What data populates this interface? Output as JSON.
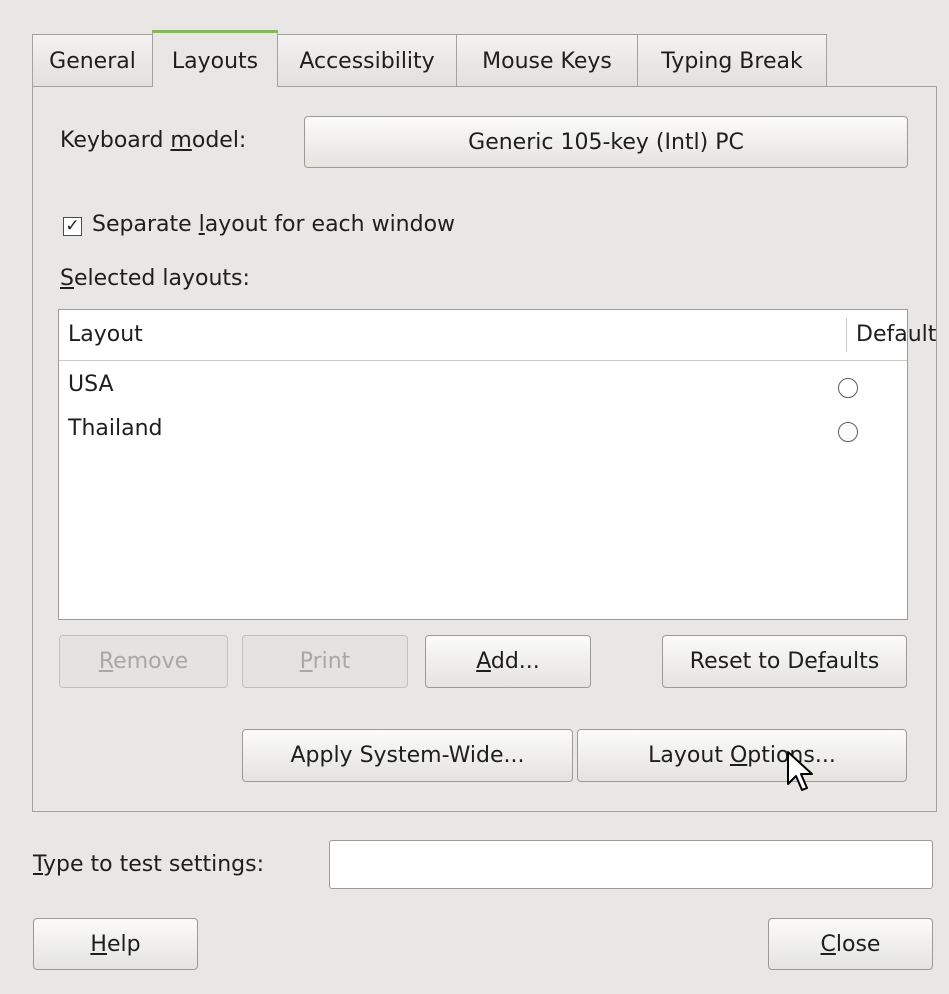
{
  "tabs": [
    {
      "label": "General"
    },
    {
      "label": "Layouts"
    },
    {
      "label": "Accessibility"
    },
    {
      "label": "Mouse Keys"
    },
    {
      "label": "Typing Break"
    }
  ],
  "keyboard_model": {
    "label_pre": "Keyboard ",
    "label_mnemonic": "m",
    "label_post": "odel:",
    "value": "Generic 105-key (Intl) PC"
  },
  "separate_layout": {
    "checked": true,
    "check_glyph": "✓",
    "label_pre": "Separate ",
    "label_mnemonic": "l",
    "label_post": "ayout for each window"
  },
  "selected_layouts": {
    "label_mnemonic": "S",
    "label_post": "elected layouts:",
    "columns": [
      "Layout",
      "Default"
    ],
    "rows": [
      {
        "layout": "USA",
        "default": false
      },
      {
        "layout": "Thailand",
        "default": false
      }
    ]
  },
  "buttons": {
    "remove": {
      "mnemonic": "R",
      "post": "emove",
      "enabled": false
    },
    "print": {
      "mnemonic": "P",
      "post": "rint",
      "enabled": false
    },
    "add": {
      "mnemonic": "A",
      "post": "dd...",
      "enabled": true
    },
    "reset": {
      "pre": "Reset to De",
      "mnemonic": "f",
      "post": "aults",
      "enabled": true
    },
    "apply_system_wide": {
      "label": "Apply System-Wide...",
      "enabled": true
    },
    "layout_options": {
      "pre": "Layout ",
      "mnemonic": "O",
      "post": "ptions...",
      "enabled": true
    },
    "help": {
      "mnemonic": "H",
      "post": "elp"
    },
    "close": {
      "mnemonic": "C",
      "post": "lose"
    }
  },
  "test_settings": {
    "label_mnemonic": "T",
    "label_post": "ype to test settings:",
    "value": ""
  }
}
